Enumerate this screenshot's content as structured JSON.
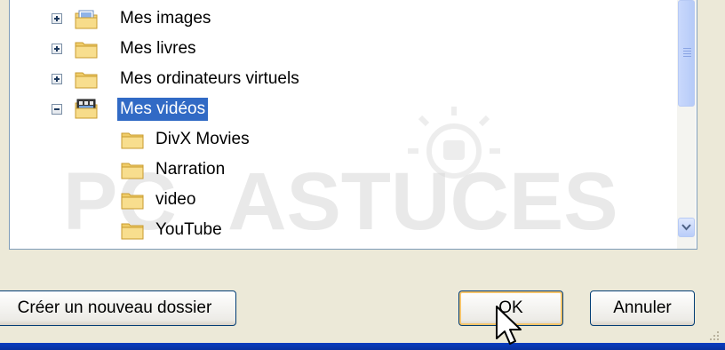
{
  "tree": {
    "items": [
      {
        "label": "Mes images",
        "expander": "plus",
        "icon": "pictures-folder-icon"
      },
      {
        "label": "Mes livres",
        "expander": "plus",
        "icon": "folder-icon"
      },
      {
        "label": "Mes ordinateurs virtuels",
        "expander": "plus",
        "icon": "folder-icon"
      },
      {
        "label": "Mes vidéos",
        "expander": "minus",
        "icon": "videos-folder-icon",
        "selected": true
      },
      {
        "label": "DivX Movies",
        "icon": "folder-icon"
      },
      {
        "label": "Narration",
        "icon": "folder-icon"
      },
      {
        "label": "video",
        "icon": "folder-icon"
      },
      {
        "label": "YouTube",
        "icon": "folder-icon"
      }
    ]
  },
  "buttons": {
    "new_folder": "Créer un nouveau dossier",
    "ok": "OK",
    "cancel": "Annuler"
  },
  "watermark": {
    "text_left": "PC",
    "text_right": "ASTUCES"
  },
  "colors": {
    "selection": "#316ac5",
    "dialog_bg": "#ece9d8",
    "scrollbar": "#c9d8fc"
  }
}
